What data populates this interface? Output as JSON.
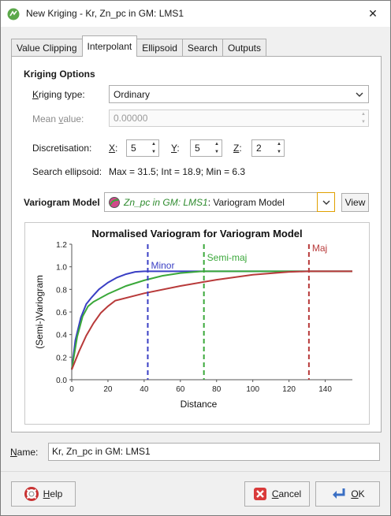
{
  "window": {
    "title": "New Kriging - Kr, Zn_pc in GM: LMS1",
    "close_glyph": "✕"
  },
  "tabs": [
    {
      "label": "Value Clipping",
      "active": false
    },
    {
      "label": "Interpolant",
      "active": true
    },
    {
      "label": "Ellipsoid",
      "active": false
    },
    {
      "label": "Search",
      "active": false
    },
    {
      "label": "Outputs",
      "active": false
    }
  ],
  "kriging_options": {
    "title": "Kriging Options",
    "type_label_u": "K",
    "type_label_rest": "riging type:",
    "type_value": "Ordinary",
    "mean_label_pre": "Mean ",
    "mean_label_u": "v",
    "mean_label_rest": "alue:",
    "mean_value": "0.00000",
    "discretisation_label": "Discretisation:",
    "x_label": "X",
    "x_value": "5",
    "y_label": "Y",
    "y_value": "5",
    "z_label": "Z",
    "z_value": "2",
    "search_ellipsoid_label": "Search ellipsoid:",
    "search_ellipsoid_value": "Max = 31.5; Int = 18.9; Min = 6.3"
  },
  "variogram_model": {
    "label": "Variogram Model",
    "selected_italic": "Zn_pc in GM: LMS1",
    "selected_rest": ": Variogram Model",
    "view_button": "View"
  },
  "chart_data": {
    "type": "line",
    "title": "Normalised Variogram for Variogram Model",
    "xlabel": "Distance",
    "ylabel": "(Semi-)Variogram",
    "xlim": [
      0,
      155
    ],
    "ylim": [
      0,
      1.2
    ],
    "xticks": [
      0,
      20,
      40,
      60,
      80,
      100,
      120,
      140
    ],
    "yticks": [
      0.0,
      0.2,
      0.4,
      0.6,
      0.8,
      1.0,
      1.2
    ],
    "grid": false,
    "series": [
      {
        "color": "#3a3fc4",
        "x": [
          0,
          2,
          5,
          8,
          11,
          15,
          20,
          25,
          30,
          35,
          40,
          42,
          155
        ],
        "y": [
          0.09,
          0.35,
          0.55,
          0.67,
          0.73,
          0.8,
          0.86,
          0.905,
          0.935,
          0.955,
          0.96,
          0.96,
          0.96
        ]
      },
      {
        "color": "#3aa83a",
        "x": [
          0,
          3,
          6,
          9,
          12,
          20,
          30,
          40,
          50,
          60,
          70,
          73,
          155
        ],
        "y": [
          0.09,
          0.38,
          0.56,
          0.65,
          0.69,
          0.76,
          0.83,
          0.88,
          0.92,
          0.945,
          0.958,
          0.96,
          0.96
        ]
      },
      {
        "color": "#b83a3a",
        "x": [
          0,
          4,
          8,
          12,
          16,
          20,
          24,
          40,
          60,
          80,
          100,
          120,
          131,
          155
        ],
        "y": [
          0.09,
          0.25,
          0.39,
          0.5,
          0.59,
          0.65,
          0.7,
          0.765,
          0.83,
          0.885,
          0.93,
          0.955,
          0.96,
          0.96
        ]
      }
    ],
    "ranges": [
      {
        "name": "Minor",
        "x": 42,
        "color": "#3a3fc4"
      },
      {
        "name": "Semi-maj",
        "x": 73,
        "color": "#3aa83a"
      },
      {
        "name": "Maj",
        "x": 131,
        "color": "#b83a3a"
      }
    ]
  },
  "name_field": {
    "label_u": "N",
    "label_rest": "ame:",
    "value": "Kr, Zn_pc in GM: LMS1"
  },
  "buttons": {
    "help_u": "H",
    "help_rest": "elp",
    "cancel_u": "C",
    "cancel_rest": "ancel",
    "ok_u": "O",
    "ok_rest": "K"
  }
}
